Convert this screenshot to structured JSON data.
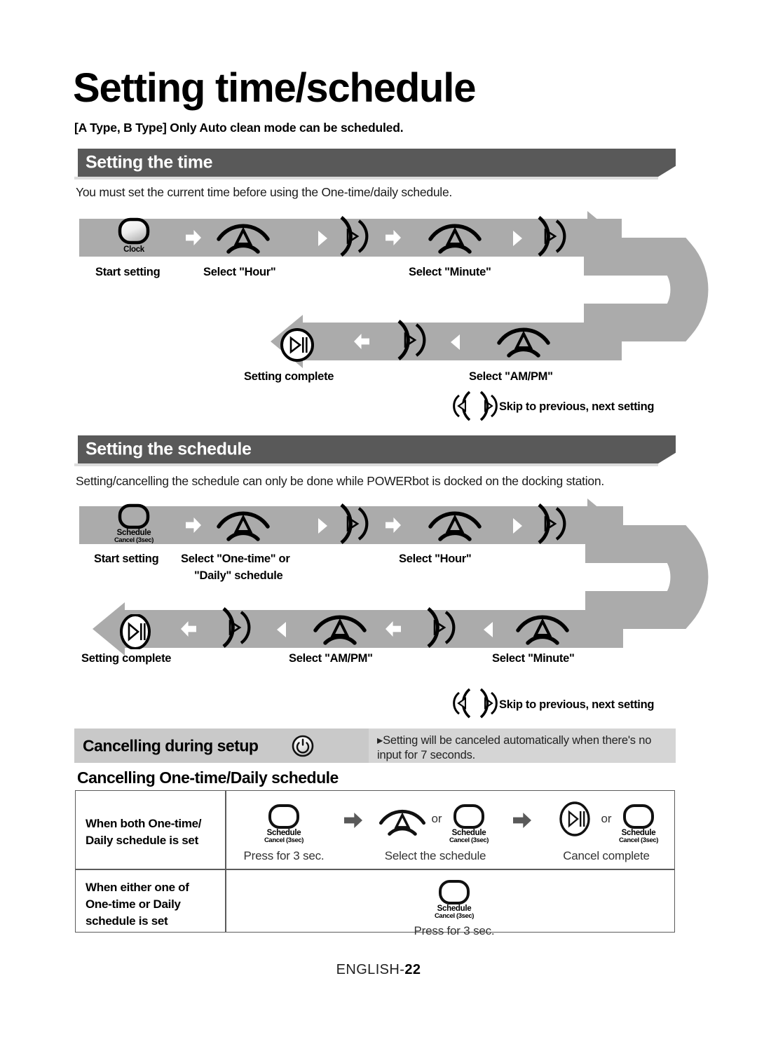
{
  "page": {
    "title": "Setting time/schedule",
    "subtitle": "[A Type, B Type] Only Auto clean mode can be scheduled.",
    "footer_prefix": "ENGLISH-",
    "footer_page": "22"
  },
  "section_time": {
    "heading": "Setting the time",
    "intro": "You must set the current time before using the One-time/daily schedule.",
    "row1": {
      "button_clock_label": "Clock",
      "captions": [
        "Start setting",
        "Select \"Hour\"",
        "Select \"Minute\""
      ]
    },
    "row2": {
      "captions": [
        "Setting complete",
        "Select \"AM/PM\""
      ]
    },
    "legend": "Skip to previous, next setting"
  },
  "section_schedule": {
    "heading": "Setting the schedule",
    "intro": "Setting/cancelling the schedule can only be done while POWERbot is docked on the docking station.",
    "row1": {
      "button_schedule_label_line1": "Schedule",
      "button_schedule_label_line2": "Cancel (3sec)",
      "captions": [
        "Start setting",
        "Select \"One-time\" or",
        "\"Daily\" schedule",
        "Select \"Hour\""
      ]
    },
    "row2": {
      "captions": [
        "Setting complete",
        "Select \"AM/PM\"",
        "Select \"Minute\""
      ]
    },
    "legend": "Skip to previous, next setting"
  },
  "cancelling": {
    "heading": "Cancelling during setup",
    "note": "Setting will be canceled automatically when there's no input for 7 seconds.",
    "subheading": "Cancelling One-time/Daily schedule"
  },
  "table": {
    "rows": [
      {
        "label_lines": [
          "When both One-time/",
          "Daily schedule is set"
        ],
        "steps": [
          {
            "caption": "Press for 3 sec."
          },
          {
            "caption": "Select the schedule",
            "or": "or"
          },
          {
            "caption": "Cancel complete",
            "or": "or"
          }
        ]
      },
      {
        "label_lines": [
          "When either one of",
          "One-time or Daily",
          "schedule is set"
        ],
        "steps": [
          {
            "caption": "Press for 3 sec."
          }
        ]
      }
    ],
    "schedule_btn_line1": "Schedule",
    "schedule_btn_line2": "Cancel (3sec)"
  },
  "colors": {
    "section_bar": "#595959",
    "flow_bar": "#ababab",
    "panel_light": "#d5d5d5",
    "panel_mid": "#c9c9c9",
    "table_border": "#5b5b5b"
  }
}
